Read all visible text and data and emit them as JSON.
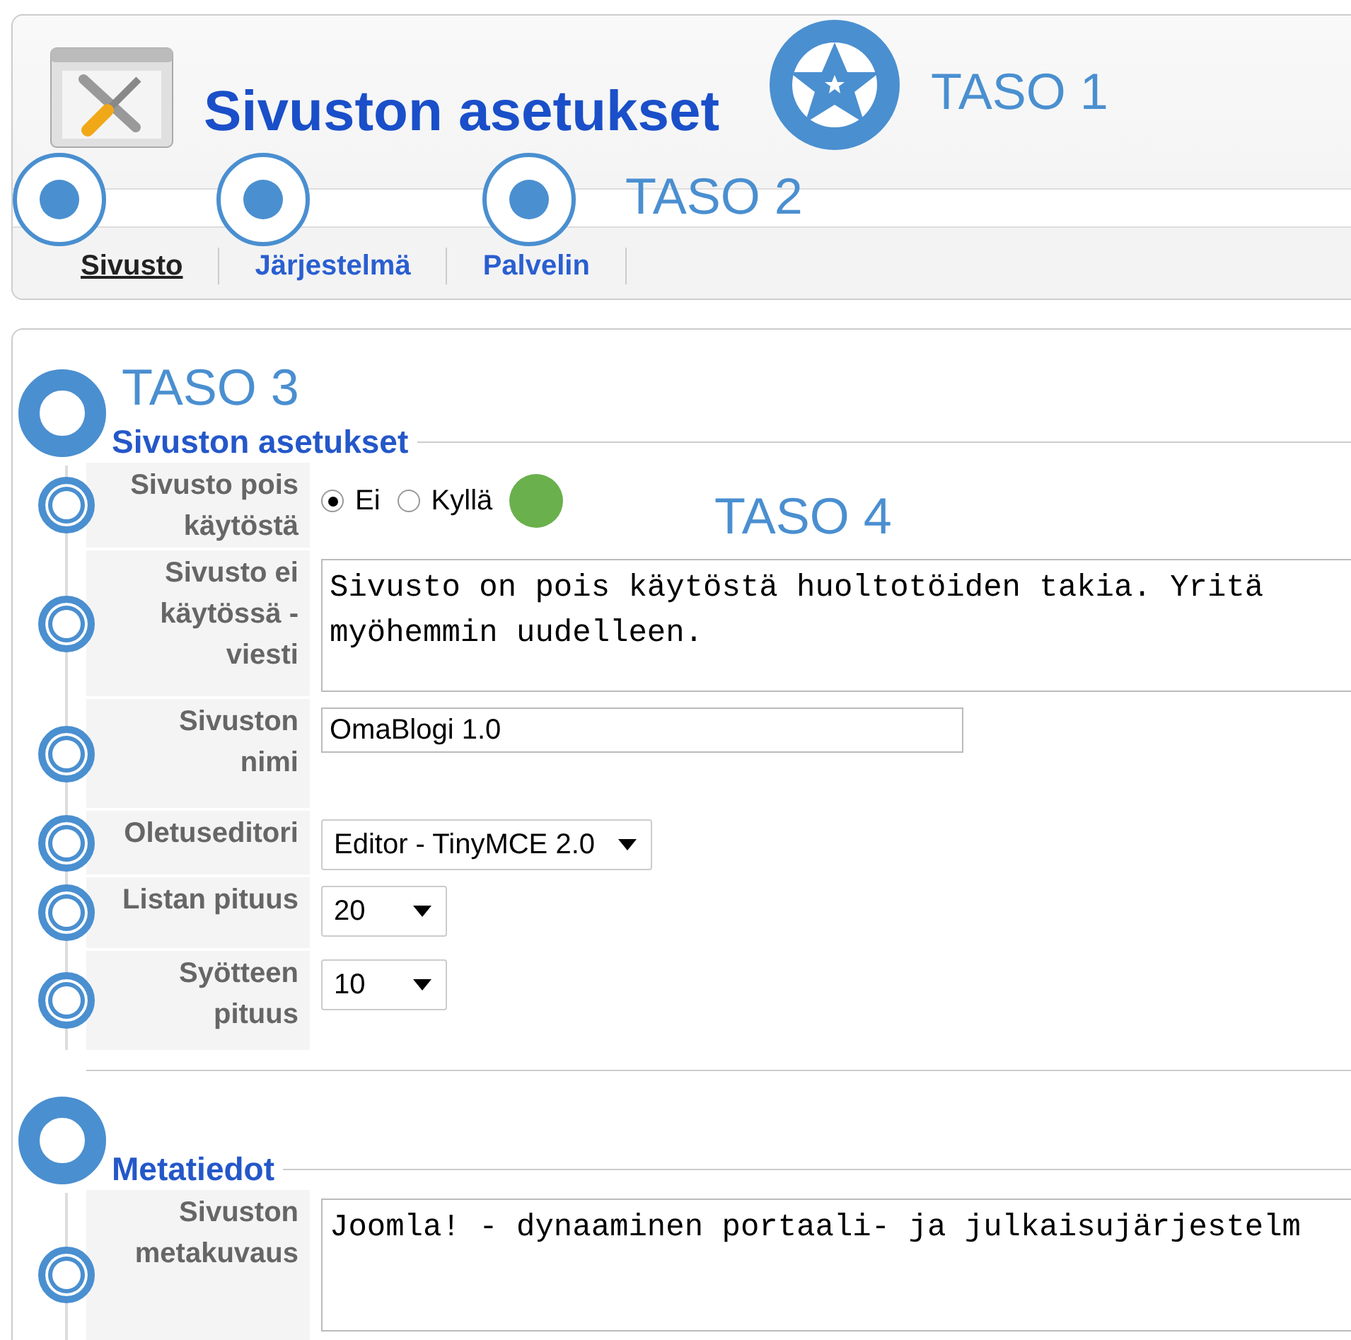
{
  "header": {
    "title": "Sivuston asetukset"
  },
  "tabs": [
    {
      "label": "Sivusto",
      "selected": true
    },
    {
      "label": "Järjestelmä",
      "selected": false
    },
    {
      "label": "Palvelin",
      "selected": false
    }
  ],
  "annotations": [
    {
      "label": "TASO 1"
    },
    {
      "label": "TASO 2"
    },
    {
      "label": "TASO 3"
    },
    {
      "label": "TASO 4"
    }
  ],
  "sections": [
    {
      "legend": "Sivuston asetukset",
      "fields": [
        {
          "kind": "radio",
          "label": "Sivusto pois käytöstä",
          "options": [
            {
              "label": "Ei",
              "selected": true
            },
            {
              "label": "Kyllä",
              "selected": false
            }
          ]
        },
        {
          "kind": "textarea",
          "label": "Sivusto ei käytössä - viesti",
          "value": "Sivusto on pois käytöstä huoltotöiden takia. Yritä myöhemmin uudelleen."
        },
        {
          "kind": "text",
          "label": "Sivuston nimi",
          "value": "OmaBlogi 1.0"
        },
        {
          "kind": "select",
          "label": "Oletuseditori",
          "value": "Editor - TinyMCE 2.0"
        },
        {
          "kind": "select",
          "label": "Listan pituus",
          "value": "20"
        },
        {
          "kind": "select",
          "label": "Syötteen pituus",
          "value": "10"
        }
      ]
    },
    {
      "legend": "Metatiedot",
      "fields": [
        {
          "kind": "textarea",
          "label": "Sivuston metakuvaus",
          "value": "Joomla! - dynaaminen portaali- ja julkaisujärjestelm"
        }
      ]
    }
  ]
}
